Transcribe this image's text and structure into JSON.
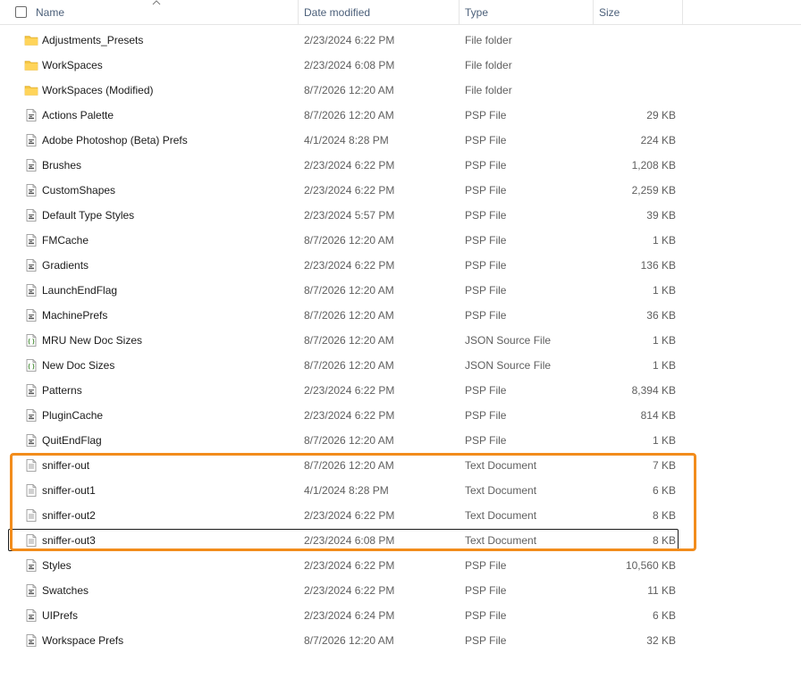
{
  "header": {
    "name": "Name",
    "date_modified": "Date modified",
    "type": "Type",
    "size": "Size"
  },
  "files": [
    {
      "name": "Adjustments_Presets",
      "date": "2/23/2024 6:22 PM",
      "type": "File folder",
      "size": "",
      "icon": "folder-icon"
    },
    {
      "name": "WorkSpaces",
      "date": "2/23/2024 6:08 PM",
      "type": "File folder",
      "size": "",
      "icon": "folder-icon"
    },
    {
      "name": "WorkSpaces (Modified)",
      "date": "8/7/2026 12:20 AM",
      "type": "File folder",
      "size": "",
      "icon": "folder-icon"
    },
    {
      "name": "Actions Palette",
      "date": "8/7/2026 12:20 AM",
      "type": "PSP File",
      "size": "29 KB",
      "icon": "psp-file-icon"
    },
    {
      "name": "Adobe Photoshop (Beta) Prefs",
      "date": "4/1/2024 8:28 PM",
      "type": "PSP File",
      "size": "224 KB",
      "icon": "psp-file-icon"
    },
    {
      "name": "Brushes",
      "date": "2/23/2024 6:22 PM",
      "type": "PSP File",
      "size": "1,208 KB",
      "icon": "psp-file-icon"
    },
    {
      "name": "CustomShapes",
      "date": "2/23/2024 6:22 PM",
      "type": "PSP File",
      "size": "2,259 KB",
      "icon": "psp-file-icon"
    },
    {
      "name": "Default Type Styles",
      "date": "2/23/2024 5:57 PM",
      "type": "PSP File",
      "size": "39 KB",
      "icon": "psp-file-icon"
    },
    {
      "name": "FMCache",
      "date": "8/7/2026 12:20 AM",
      "type": "PSP File",
      "size": "1 KB",
      "icon": "psp-file-icon"
    },
    {
      "name": "Gradients",
      "date": "2/23/2024 6:22 PM",
      "type": "PSP File",
      "size": "136 KB",
      "icon": "psp-file-icon"
    },
    {
      "name": "LaunchEndFlag",
      "date": "8/7/2026 12:20 AM",
      "type": "PSP File",
      "size": "1 KB",
      "icon": "psp-file-icon"
    },
    {
      "name": "MachinePrefs",
      "date": "8/7/2026 12:20 AM",
      "type": "PSP File",
      "size": "36 KB",
      "icon": "psp-file-icon"
    },
    {
      "name": "MRU New Doc Sizes",
      "date": "8/7/2026 12:20 AM",
      "type": "JSON Source File",
      "size": "1 KB",
      "icon": "json-file-icon"
    },
    {
      "name": "New Doc Sizes",
      "date": "8/7/2026 12:20 AM",
      "type": "JSON Source File",
      "size": "1 KB",
      "icon": "json-file-icon"
    },
    {
      "name": "Patterns",
      "date": "2/23/2024 6:22 PM",
      "type": "PSP File",
      "size": "8,394 KB",
      "icon": "psp-file-icon"
    },
    {
      "name": "PluginCache",
      "date": "2/23/2024 6:22 PM",
      "type": "PSP File",
      "size": "814 KB",
      "icon": "psp-file-icon"
    },
    {
      "name": "QuitEndFlag",
      "date": "8/7/2026 12:20 AM",
      "type": "PSP File",
      "size": "1 KB",
      "icon": "psp-file-icon"
    },
    {
      "name": "sniffer-out",
      "date": "8/7/2026 12:20 AM",
      "type": "Text Document",
      "size": "7 KB",
      "icon": "text-file-icon"
    },
    {
      "name": "sniffer-out1",
      "date": "4/1/2024 8:28 PM",
      "type": "Text Document",
      "size": "6 KB",
      "icon": "text-file-icon"
    },
    {
      "name": "sniffer-out2",
      "date": "2/23/2024 6:22 PM",
      "type": "Text Document",
      "size": "8 KB",
      "icon": "text-file-icon"
    },
    {
      "name": "sniffer-out3",
      "date": "2/23/2024 6:08 PM",
      "type": "Text Document",
      "size": "8 KB",
      "icon": "text-file-icon",
      "focused": true
    },
    {
      "name": "Styles",
      "date": "2/23/2024 6:22 PM",
      "type": "PSP File",
      "size": "10,560 KB",
      "icon": "psp-file-icon"
    },
    {
      "name": "Swatches",
      "date": "2/23/2024 6:22 PM",
      "type": "PSP File",
      "size": "11 KB",
      "icon": "psp-file-icon"
    },
    {
      "name": "UIPrefs",
      "date": "2/23/2024 6:24 PM",
      "type": "PSP File",
      "size": "6 KB",
      "icon": "psp-file-icon"
    },
    {
      "name": "Workspace Prefs",
      "date": "8/7/2026 12:20 AM",
      "type": "PSP File",
      "size": "32 KB",
      "icon": "psp-file-icon"
    }
  ],
  "colors": {
    "highlight": "#f28c1c",
    "folder": "#f4c542",
    "header_text": "#4c607a"
  }
}
